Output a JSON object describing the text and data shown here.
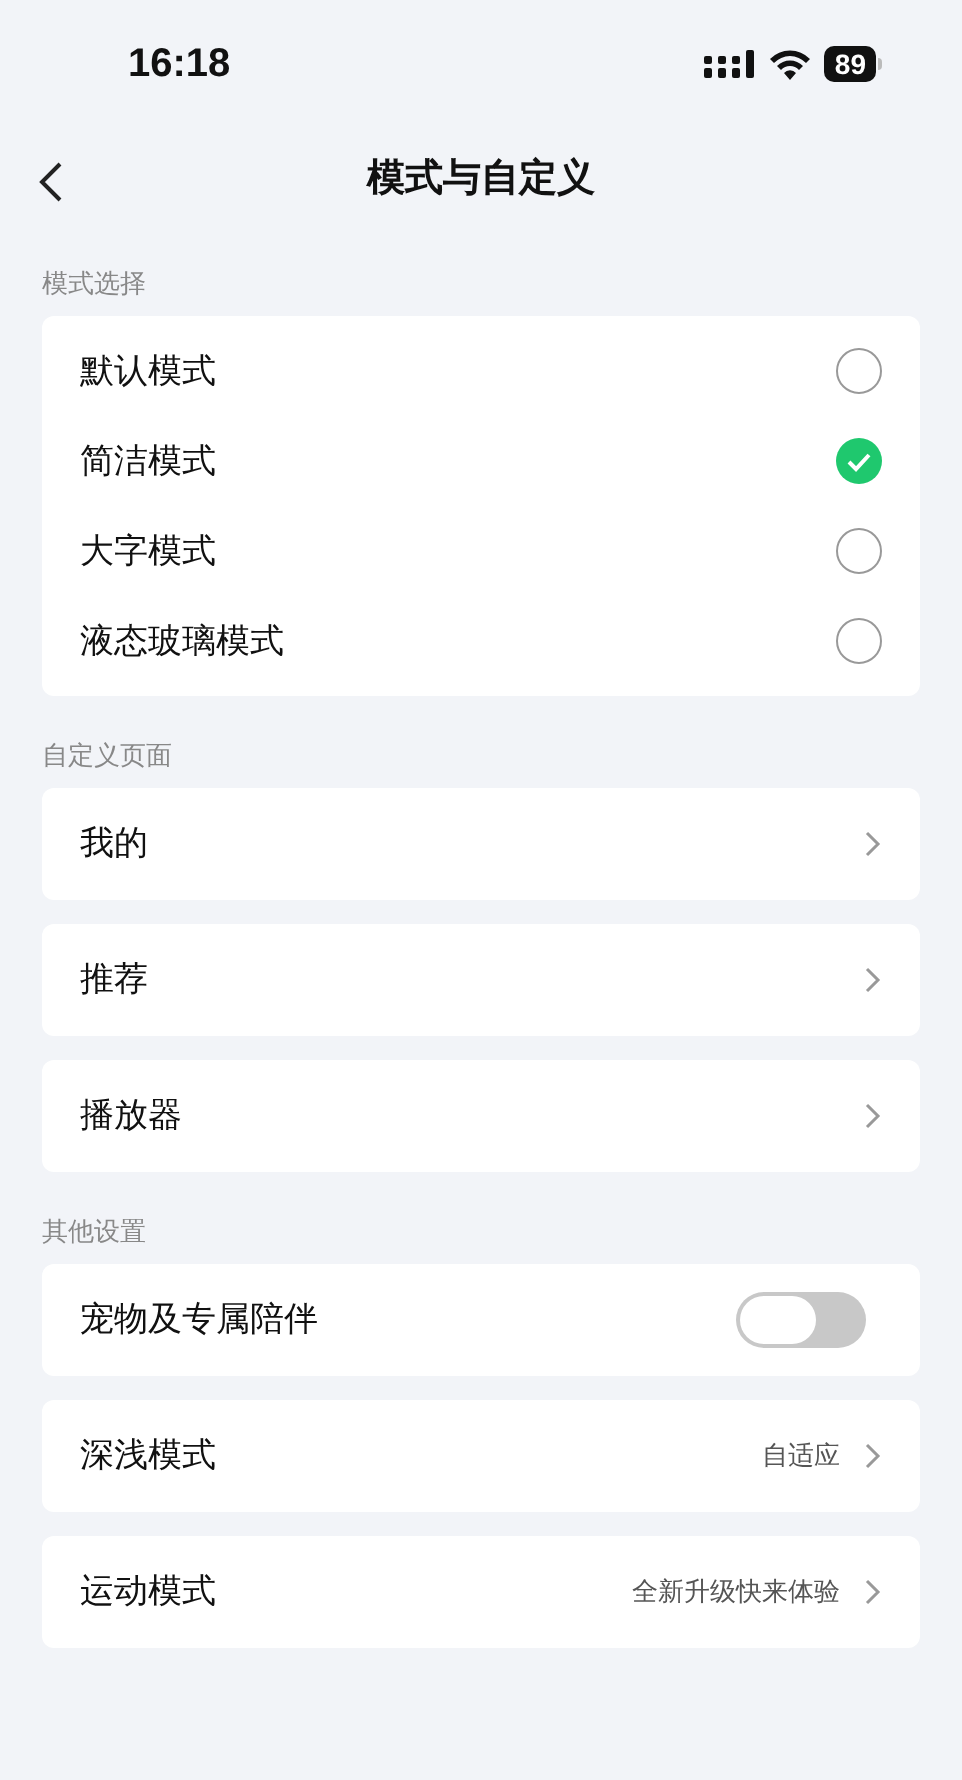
{
  "status_bar": {
    "time": "16:18",
    "battery": "89"
  },
  "nav": {
    "title": "模式与自定义"
  },
  "sections": [
    {
      "header": "模式选择",
      "kind": "group",
      "items": [
        {
          "kind": "radio",
          "label": "默认模式",
          "selected": false
        },
        {
          "kind": "radio",
          "label": "简洁模式",
          "selected": true
        },
        {
          "kind": "radio",
          "label": "大字模式",
          "selected": false
        },
        {
          "kind": "radio",
          "label": "液态玻璃模式",
          "selected": false
        }
      ]
    },
    {
      "header": "自定义页面",
      "kind": "separate",
      "items": [
        {
          "kind": "link",
          "label": "我的"
        },
        {
          "kind": "link",
          "label": "推荐"
        },
        {
          "kind": "link",
          "label": "播放器"
        }
      ]
    },
    {
      "header": "其他设置",
      "kind": "separate",
      "items": [
        {
          "kind": "toggle",
          "label": "宠物及专属陪伴",
          "on": false
        },
        {
          "kind": "link",
          "label": "深浅模式",
          "value": "自适应"
        },
        {
          "kind": "link",
          "label": "运动模式",
          "value": "全新升级快来体验"
        }
      ]
    }
  ]
}
